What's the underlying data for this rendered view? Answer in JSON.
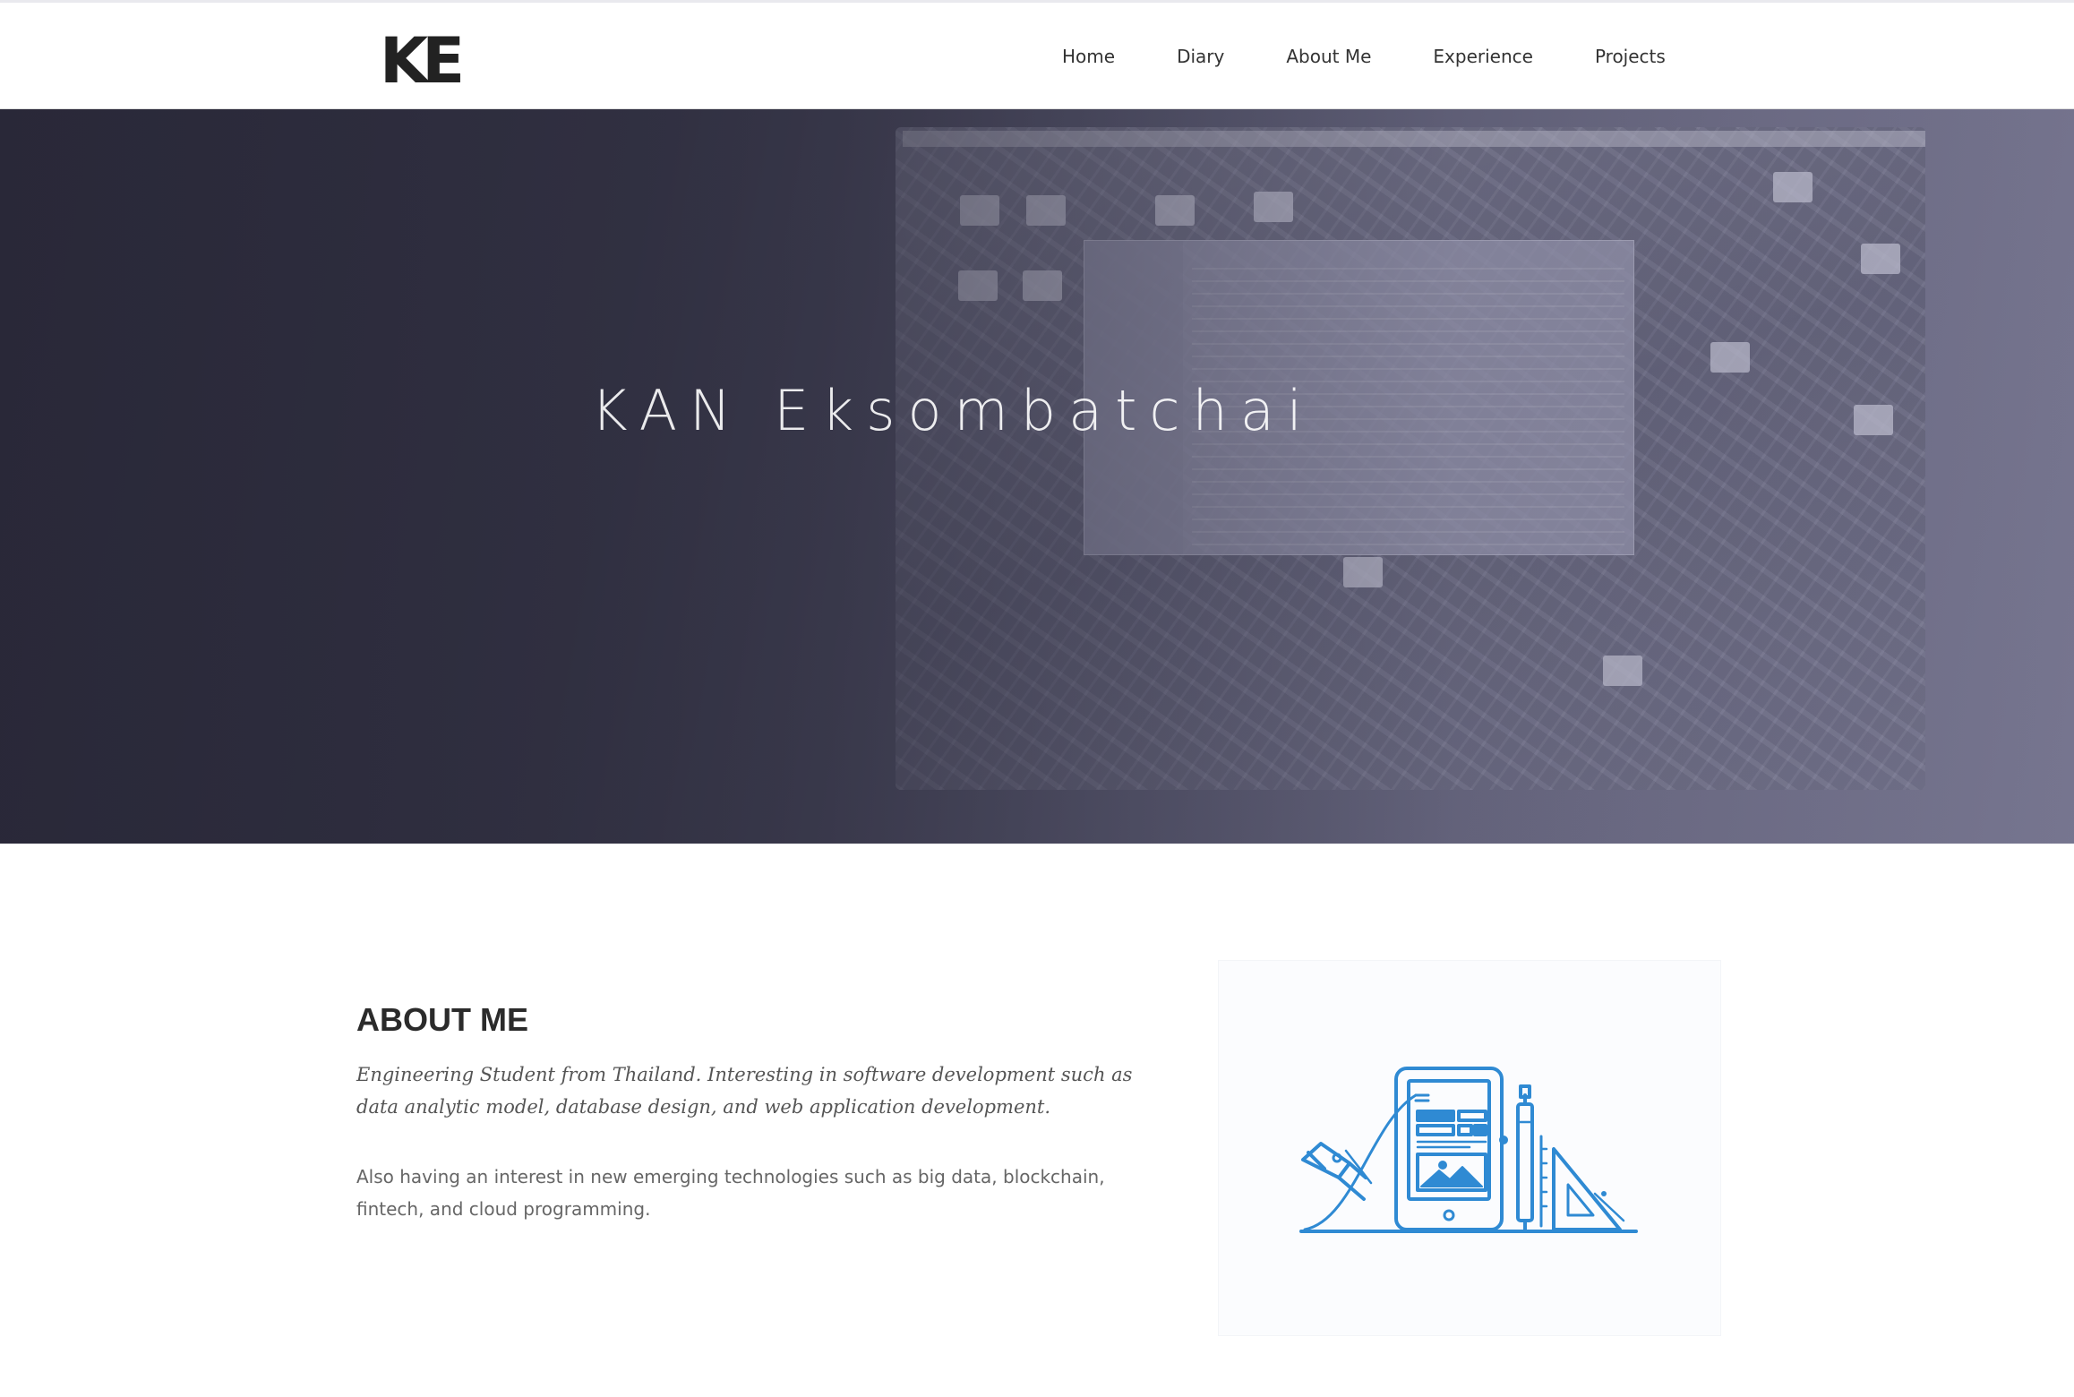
{
  "header": {
    "logo_text": "KE",
    "nav": [
      "Home",
      "Diary",
      "About Me",
      "Experience",
      "Projects"
    ]
  },
  "hero": {
    "title": "KAN Eksombatchai"
  },
  "about": {
    "heading": "ABOUT ME",
    "lead": "Engineering Student from Thailand. Interesting in software development such as data analytic model, database design, and web application development.",
    "body": "Also having an interest in new emerging technologies such as big data, blockchain, fintech, and cloud programming."
  },
  "colors": {
    "accent_blue": "#2f8ad3",
    "hero_dark": "#2f2e3f",
    "hero_light": "#7b7a94"
  }
}
